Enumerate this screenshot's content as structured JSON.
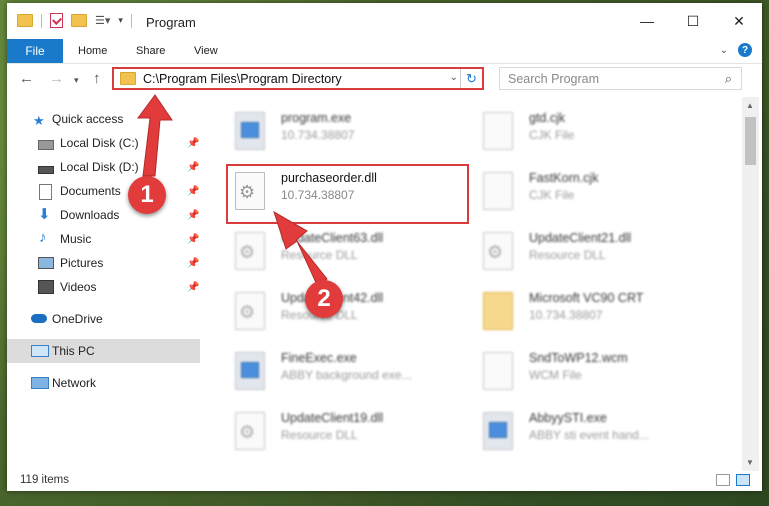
{
  "window": {
    "title": "Program"
  },
  "ribbon": {
    "tabs": [
      "File",
      "Home",
      "Share",
      "View"
    ]
  },
  "address": {
    "path": "C:\\Program Files\\Program Directory"
  },
  "search": {
    "placeholder": "Search Program"
  },
  "sidebar": {
    "items": [
      {
        "label": "Quick access",
        "icon": "star-icon"
      },
      {
        "label": "Local Disk (C:)",
        "icon": "drive-icon",
        "pinned": true
      },
      {
        "label": "Local Disk (D:)",
        "icon": "drive-icon",
        "pinned": true
      },
      {
        "label": "Documents",
        "icon": "documents-icon",
        "pinned": true
      },
      {
        "label": "Downloads",
        "icon": "downloads-icon",
        "pinned": true
      },
      {
        "label": "Music",
        "icon": "music-icon",
        "pinned": true
      },
      {
        "label": "Pictures",
        "icon": "pictures-icon",
        "pinned": true
      },
      {
        "label": "Videos",
        "icon": "videos-icon",
        "pinned": true
      },
      {
        "label": "OneDrive",
        "icon": "cloud-icon"
      },
      {
        "label": "This PC",
        "icon": "pc-icon",
        "selected": true
      },
      {
        "label": "Network",
        "icon": "network-icon"
      }
    ]
  },
  "files": [
    {
      "name": "program.exe",
      "sub": "10.734.38807"
    },
    {
      "name": "gtd.cjk",
      "sub": "CJK File"
    },
    {
      "name": "purchaseorder.dll",
      "sub": "10.734.38807"
    },
    {
      "name": "FastKorn.cjk",
      "sub": "CJK File"
    },
    {
      "name": "UpdateClient63.dll",
      "sub": "Resource DLL"
    },
    {
      "name": "UpdateClient21.dll",
      "sub": "Resource DLL"
    },
    {
      "name": "UpdateClient42.dll",
      "sub": "Resource DLL"
    },
    {
      "name": "Microsoft VC90 CRT",
      "sub": "10.734.38807"
    },
    {
      "name": "FineExec.exe",
      "sub": "ABBY background exe..."
    },
    {
      "name": "SndToWP12.wcm",
      "sub": "WCM File"
    },
    {
      "name": "UpdateClient19.dll",
      "sub": "Resource DLL"
    },
    {
      "name": "AbbyySTI.exe",
      "sub": "ABBY sti event hand..."
    }
  ],
  "status": {
    "items": "119 items"
  },
  "callouts": {
    "one": "1",
    "two": "2"
  },
  "colors": {
    "accent": "#1979ca",
    "highlight": "#d93c3c"
  }
}
